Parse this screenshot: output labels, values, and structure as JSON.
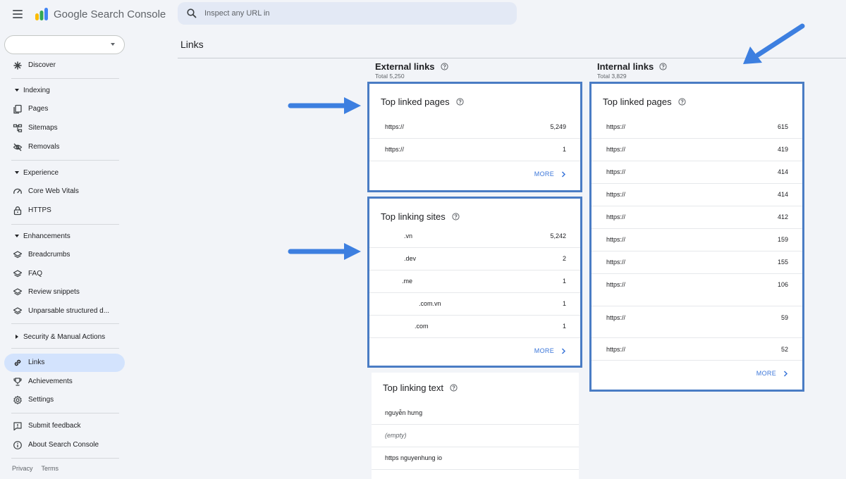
{
  "app": {
    "brand": "Google Search Console",
    "search_placeholder": "Inspect any URL in"
  },
  "sidebar": {
    "property": "",
    "discover": "Discover",
    "sections": [
      {
        "label": "Indexing",
        "items": [
          "Pages",
          "Sitemaps",
          "Removals"
        ]
      },
      {
        "label": "Experience",
        "items": [
          "Core Web Vitals",
          "HTTPS"
        ]
      },
      {
        "label": "Enhancements",
        "items": [
          "Breadcrumbs",
          "FAQ",
          "Review snippets",
          "Unparsable structured d..."
        ]
      },
      {
        "label": "Security & Manual Actions"
      }
    ],
    "links": "Links",
    "achievements": "Achievements",
    "settings": "Settings",
    "submit_feedback": "Submit feedback",
    "about": "About Search Console",
    "footer": {
      "privacy": "Privacy",
      "terms": "Terms"
    }
  },
  "page": {
    "title": "Links"
  },
  "external": {
    "title": "External links",
    "total": "Total 5,250",
    "top_linked_pages": {
      "title": "Top linked pages",
      "rows": [
        {
          "url": "https://",
          "count": "5,249"
        },
        {
          "url": "https://",
          "count": "1"
        }
      ],
      "more": "MORE"
    },
    "top_linking_sites": {
      "title": "Top linking sites",
      "rows": [
        {
          "site": ".vn",
          "count": "5,242"
        },
        {
          "site": ".dev",
          "count": "2"
        },
        {
          "site": ".me",
          "count": "1"
        },
        {
          "site": ".com.vn",
          "count": "1"
        },
        {
          "site": ".com",
          "count": "1"
        }
      ],
      "more": "MORE"
    },
    "top_linking_text": {
      "title": "Top linking text",
      "rows": [
        "nguyễn hưng",
        "(empty)",
        "https nguyenhung io"
      ]
    }
  },
  "internal": {
    "title": "Internal links",
    "total": "Total 3,829",
    "top_linked_pages": {
      "title": "Top linked pages",
      "rows": [
        {
          "url": "https://",
          "count": "615"
        },
        {
          "url": "https://",
          "count": "419"
        },
        {
          "url": "https://",
          "count": "414"
        },
        {
          "url": "https://",
          "count": "414"
        },
        {
          "url": "https://",
          "count": "412"
        },
        {
          "url": "https://",
          "count": "159"
        },
        {
          "url": "https://",
          "count": "155"
        },
        {
          "url": "https://",
          "count": "106"
        },
        {
          "url": "https://",
          "count": "59"
        },
        {
          "url": "https://",
          "count": "52"
        }
      ],
      "more": "MORE"
    }
  },
  "colors": {
    "highlight": "#4a7cc4",
    "arrow": "#3d7fe0",
    "accent_link": "#3b76d9",
    "active_nav": "#d3e3fd"
  }
}
